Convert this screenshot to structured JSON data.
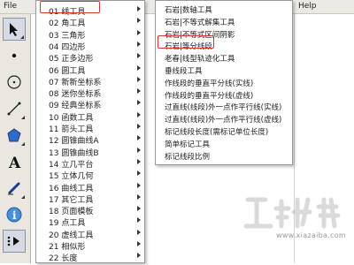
{
  "menubar": {
    "file": "File",
    "help": "Help"
  },
  "menu1": {
    "items": [
      {
        "label": "01 线工具"
      },
      {
        "label": "02 角工具"
      },
      {
        "label": "03 三角形"
      },
      {
        "label": "04 四边形"
      },
      {
        "label": "05 正多边形"
      },
      {
        "label": "06 圆工具"
      },
      {
        "label": "07 新新坐标系"
      },
      {
        "label": "08 迷你坐标系"
      },
      {
        "label": "09 经典坐标系"
      },
      {
        "label": "10 函数工具"
      },
      {
        "label": "11 箭头工具"
      },
      {
        "label": "12 圆锥曲线A"
      },
      {
        "label": "13 圆锥曲线B"
      },
      {
        "label": "14 立几平台"
      },
      {
        "label": "15 立体几何"
      },
      {
        "label": "16 曲线工具"
      },
      {
        "label": "17 其它工具"
      },
      {
        "label": "18 页面模板"
      },
      {
        "label": "19 点工具"
      },
      {
        "label": "20 虚线工具"
      },
      {
        "label": "21 相似形"
      },
      {
        "label": "22 长度"
      }
    ]
  },
  "menu2": {
    "items": [
      {
        "label": "石岩|数轴工具"
      },
      {
        "label": "石岩|不等式解集工具"
      },
      {
        "label": "石岩|不等式区间阴影"
      },
      {
        "label": "石岩|等分线段"
      },
      {
        "label": "老春|线型轨迹化工具"
      },
      {
        "label": "垂线段工具"
      },
      {
        "label": "作线段的垂直平分线(实线)"
      },
      {
        "label": "作线段的垂直平分线(虚线)"
      },
      {
        "label": "过直线(线段)外一点作平行线(实线)"
      },
      {
        "label": "过直线(线段)外一点作平行线(虚线)"
      },
      {
        "label": "标记线段长度(需标记单位长度)"
      },
      {
        "label": "简单标记工具"
      },
      {
        "label": "标记线段比例"
      }
    ]
  },
  "toolbar": {
    "tools": [
      "select-arrow",
      "point",
      "compass",
      "straightedge",
      "polygon",
      "text",
      "marker",
      "information",
      "custom-tools"
    ]
  },
  "colors": {
    "highlight": "#d8372f",
    "toolbar_bg": "#e9e7e0"
  },
  "watermark": {
    "text": "www.xiazaiba.com"
  }
}
